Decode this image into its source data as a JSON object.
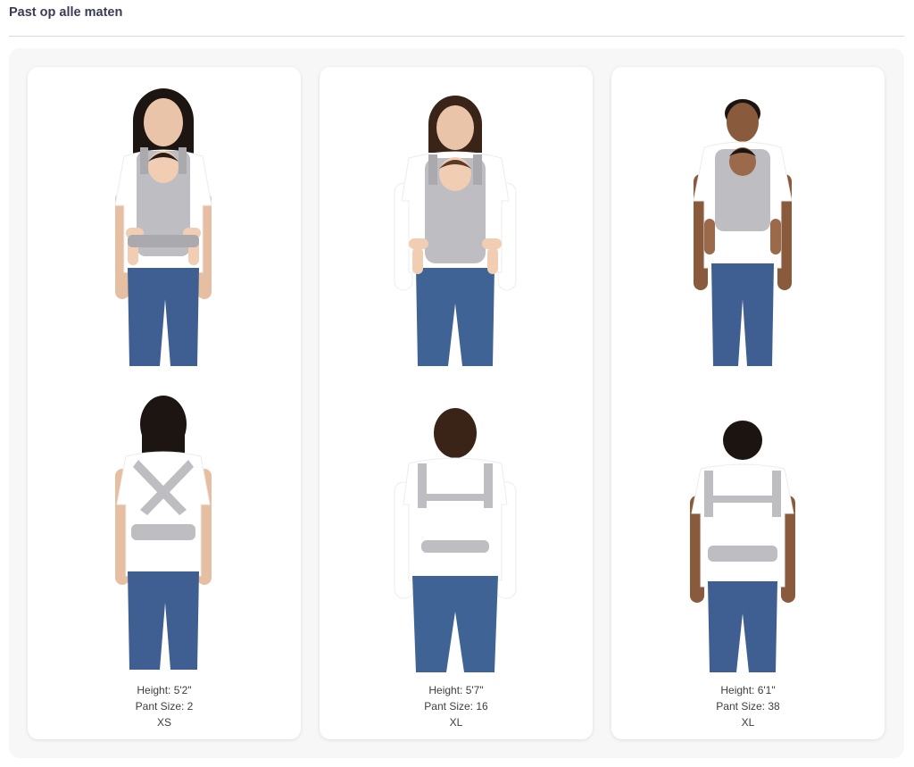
{
  "section_title": "Past op alle maten",
  "colors": {
    "title_text": "#3a3b55",
    "panel_bg": "#f7f7f7",
    "card_bg": "#ffffff",
    "carrier_gray": "#bdbdc2",
    "denim": "#3f5f92",
    "shirt": "#ffffff"
  },
  "cards": [
    {
      "height": "Height: 5'2\"",
      "pant": "Pant Size: 2",
      "size": "XS"
    },
    {
      "height": "Height: 5'7\"",
      "pant": "Pant Size: 16",
      "size": "XL"
    },
    {
      "height": "Height: 6'1\"",
      "pant": "Pant Size: 38",
      "size": "XL"
    }
  ]
}
